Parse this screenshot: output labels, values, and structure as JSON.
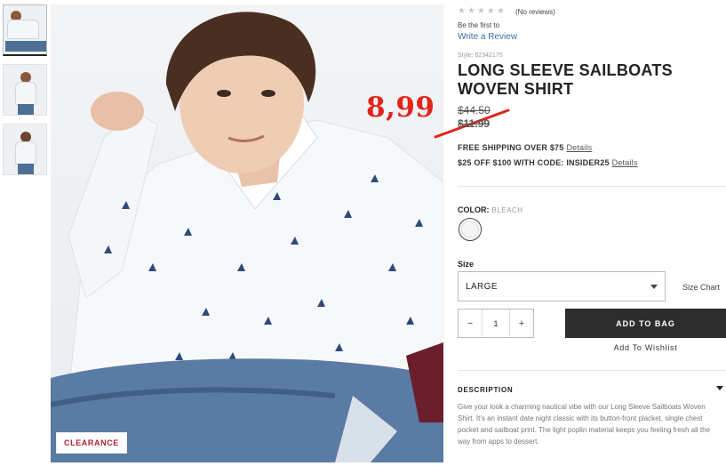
{
  "thumbnails": [
    {
      "name": "thumb-1",
      "active": true
    },
    {
      "name": "thumb-2",
      "active": false
    },
    {
      "name": "thumb-3",
      "active": false
    }
  ],
  "image": {
    "badge": "CLEARANCE"
  },
  "overlay": {
    "price": "8,99",
    "color": "#e1251b"
  },
  "product": {
    "stars": "★★★★★",
    "reviews_count": "(No reviews)",
    "be_first": "Be the first to",
    "write_review": "Write a Review",
    "style": "Style: 62342175",
    "title": "LONG SLEEVE SAILBOATS WOVEN SHIRT",
    "price_original": "$44.50",
    "price_sale": "$11.99",
    "promo_shipping": "FREE SHIPPING OVER $75",
    "promo_shipping_link": "Details",
    "promo_code": "$25 OFF $100 WITH CODE: INSIDER25",
    "promo_code_link": "Details",
    "color_label": "COLOR:",
    "color_value": "BLEACH",
    "size_label": "Size",
    "size_value": "LARGE",
    "size_chart": "Size Chart",
    "qty_minus": "−",
    "qty_value": "1",
    "qty_plus": "+",
    "add_to_bag": "ADD TO BAG",
    "wishlist": "Add To Wishlist",
    "description_title": "DESCRIPTION",
    "description": "Give your look a charming nautical vibe with our Long Sleeve Sailboats Woven Shirt. It's an instant date night classic with its button-front placket, single chest pocket and sailboat print. The light poplin material keeps you feeling fresh all the way from apps to dessert."
  },
  "colors": {
    "link": "#3a6fa8",
    "add_to_bag_bg": "#2d2d2d",
    "clearance": "#b22234"
  }
}
